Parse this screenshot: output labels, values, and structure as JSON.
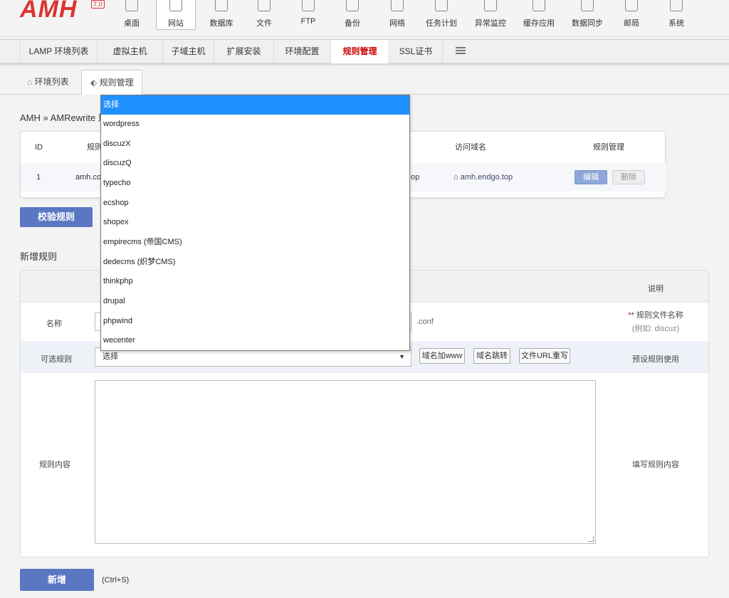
{
  "header": {
    "logo": "AMH",
    "version": "7.0",
    "nav": [
      {
        "label": "桌面",
        "icon": "desktop-icon"
      },
      {
        "label": "网站",
        "icon": "website-icon",
        "active": true
      },
      {
        "label": "数据库",
        "icon": "database-icon"
      },
      {
        "label": "文件",
        "icon": "file-icon"
      },
      {
        "label": "FTP",
        "icon": "ftp-icon"
      },
      {
        "label": "备份",
        "icon": "backup-icon"
      },
      {
        "label": "网络",
        "icon": "network-icon"
      },
      {
        "label": "任务计划",
        "icon": "schedule-icon"
      },
      {
        "label": "异常监控",
        "icon": "monitor-icon"
      },
      {
        "label": "缓存应用",
        "icon": "cache-icon"
      },
      {
        "label": "数据同步",
        "icon": "sync-icon"
      },
      {
        "label": "邮局",
        "icon": "mail-icon"
      },
      {
        "label": "系统",
        "icon": "system-icon"
      }
    ]
  },
  "nav2": {
    "tabs": [
      "LAMP 环境列表",
      "虚拟主机",
      "子域主机",
      "扩展安装",
      "环境配置",
      "规则管理",
      "SSL证书"
    ]
  },
  "subtabs": {
    "env_list": "环境列表",
    "rule_manage": "规则管理"
  },
  "breadcrumb": "AMH » AMRewrite 规",
  "rule_table": {
    "headers": {
      "id": "ID",
      "rule": "规则",
      "domain": "访问域名",
      "manage": "规则管理"
    },
    "row": {
      "id": "1",
      "rule": "amh.con",
      "suffix": "op",
      "domain": "amh.endgo.top",
      "edit": "编辑",
      "delete": "删除"
    }
  },
  "check_button": "校验规则",
  "new_rule_title": "新增规则",
  "form": {
    "header_note": "说明",
    "name_label": "名称",
    "name_suffix": ".conf",
    "name_note1": "* 规则文件名称",
    "name_note2": "(例如: discuz)",
    "optional_label": "可选规则",
    "select_value": "选择",
    "btn_www": "域名加www",
    "btn_redirect": "域名跳转",
    "btn_url": "文件URL重写",
    "optional_note": "预设规则使用",
    "content_label": "规则内容",
    "content_note": "填写规则内容"
  },
  "add_button": "新增",
  "hotkey": "(Ctrl+S)",
  "dropdown": {
    "options": [
      "选择",
      "wordpress",
      "discuzX",
      "discuzQ",
      "typecho",
      "ecshop",
      "shopex",
      "empirecms (帝国CMS)",
      "dedecms (织梦CMS)",
      "thinkphp",
      "drupal",
      "phpwind",
      "wecenter"
    ],
    "selected_index": 0,
    "highlight_color": "#1e90ff"
  },
  "colors": {
    "brand_red": "#dd3333",
    "button_blue": "#5a77c2",
    "active_tab_red": "#cc0000"
  }
}
